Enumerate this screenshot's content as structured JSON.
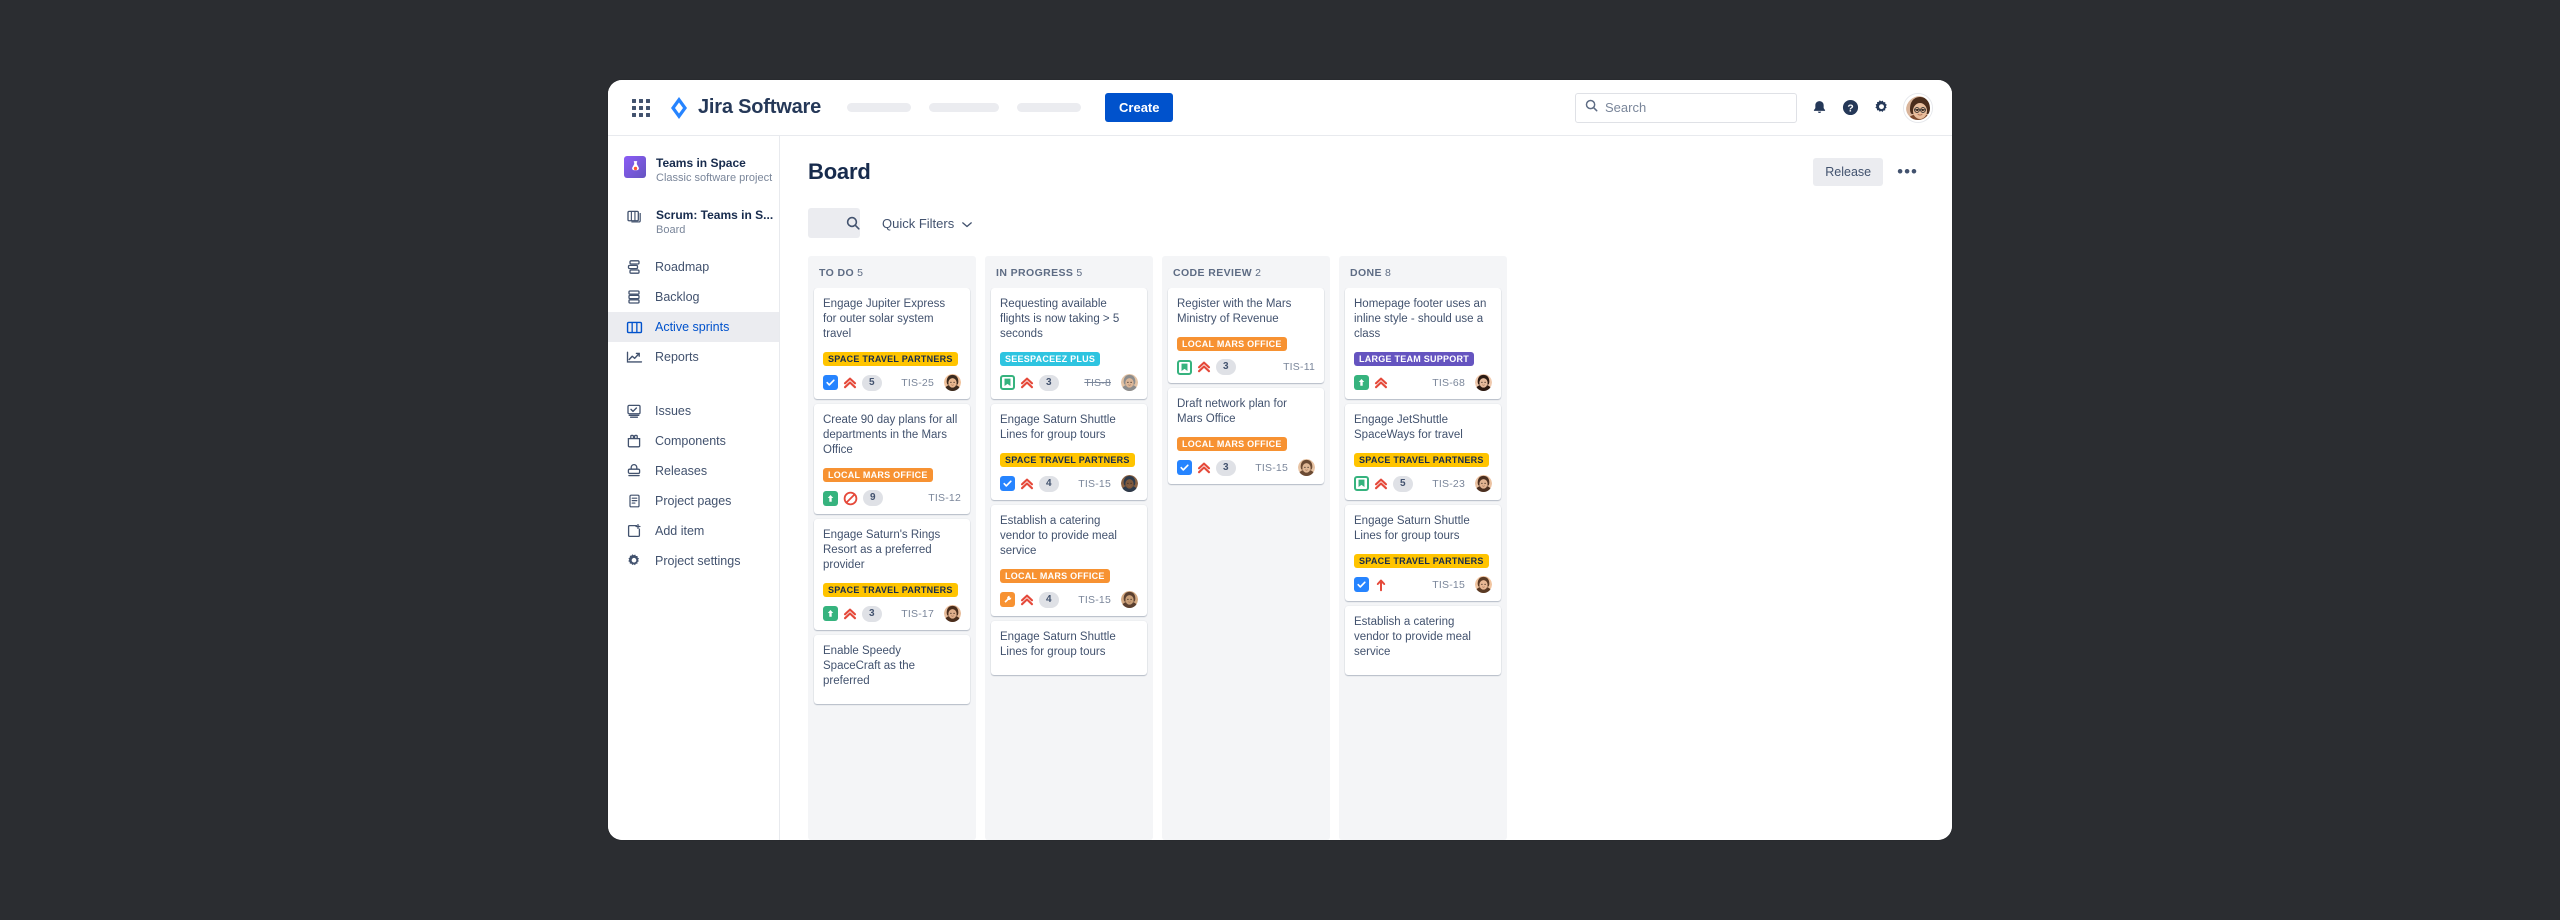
{
  "topnav": {
    "app_switcher_icon": "grid-apps-icon",
    "brand": "Jira Software",
    "brand_icon": "jira-logo-icon",
    "create_label": "Create",
    "search_placeholder": "Search",
    "search_value": "",
    "search_icon": "search-icon",
    "notifications_icon": "bell-icon",
    "help_icon": "help-circle-icon",
    "settings_icon": "gear-icon",
    "profile_icon": "user-avatar"
  },
  "sidebar": {
    "project": {
      "name": "Teams in Space",
      "subtitle": "Classic software project",
      "avatar_icon": "project-rocket-icon"
    },
    "board": {
      "name": "Scrum: Teams in S...",
      "subtitle": "Board",
      "icon": "board-stack-icon",
      "chevron_icon": "chevron-down-icon"
    },
    "items": [
      {
        "label": "Roadmap",
        "icon": "roadmap-icon",
        "active": false
      },
      {
        "label": "Backlog",
        "icon": "backlog-icon",
        "active": false
      },
      {
        "label": "Active sprints",
        "icon": "active-sprints-icon",
        "active": true
      },
      {
        "label": "Reports",
        "icon": "reports-icon",
        "active": false
      }
    ],
    "items2": [
      {
        "label": "Issues",
        "icon": "issues-icon",
        "active": false
      },
      {
        "label": "Components",
        "icon": "components-icon",
        "active": false
      },
      {
        "label": "Releases",
        "icon": "releases-icon",
        "active": false
      },
      {
        "label": "Project pages",
        "icon": "project-pages-icon",
        "active": false
      },
      {
        "label": "Add item",
        "icon": "add-item-icon",
        "active": false
      },
      {
        "label": "Project settings",
        "icon": "project-settings-icon",
        "active": false
      }
    ]
  },
  "main": {
    "title": "Board",
    "release_label": "Release",
    "more_label": "•••",
    "search_icon": "search-icon",
    "search_value": "",
    "quick_filters_label": "Quick Filters",
    "quick_filters_chevron": "chevron-down-icon"
  },
  "colors": {
    "brand_blue": "#0052cc",
    "label_yellow": "#ffc400",
    "label_orange": "#f79232",
    "label_teal": "#2ec4e0",
    "label_purple": "#6554c0",
    "type_task_blue": "#2684ff",
    "type_story_green": "#36b37e",
    "priority_red": "#e5493a",
    "column_bg": "#f4f5f7",
    "text_primary": "#172b4d",
    "text_muted": "#5e6c84"
  },
  "board": {
    "columns": [
      {
        "name": "TO DO",
        "count": "5",
        "cards": [
          {
            "title": "Engage Jupiter Express for outer solar system travel",
            "label": "SPACE TRAVEL PARTNERS",
            "label_color": "yellow",
            "type": "task",
            "priority": "highest",
            "points": "5",
            "key": "TIS-25",
            "key_done": false,
            "avatar": "avatar-male-1"
          },
          {
            "title": "Create 90 day plans for all departments in the Mars Office",
            "label": "LOCAL MARS OFFICE",
            "label_color": "orange",
            "type": "story",
            "priority": "blocker",
            "points": "9",
            "key": "TIS-12",
            "key_done": false,
            "avatar": null
          },
          {
            "title": "Engage Saturn's Rings Resort as a preferred provider",
            "label": "SPACE TRAVEL PARTNERS",
            "label_color": "yellow",
            "type": "story",
            "priority": "highest",
            "points": "3",
            "key": "TIS-17",
            "key_done": false,
            "avatar": "avatar-female-1"
          },
          {
            "title": "Enable Speedy SpaceCraft as the preferred",
            "label": null,
            "label_color": null,
            "type": null,
            "priority": null,
            "points": null,
            "key": null,
            "key_done": false,
            "avatar": null
          }
        ]
      },
      {
        "name": "IN PROGRESS",
        "count": "5",
        "cards": [
          {
            "title": "Requesting available flights is now taking > 5 seconds",
            "label": "SEESPACEEZ PLUS",
            "label_color": "teal",
            "type": "story-bookmark",
            "priority": "highest",
            "points": "3",
            "key": "TIS-8",
            "key_done": true,
            "avatar": "avatar-male-2"
          },
          {
            "title": "Engage Saturn Shuttle Lines for group tours",
            "label": "SPACE TRAVEL PARTNERS",
            "label_color": "yellow",
            "type": "task",
            "priority": "highest",
            "points": "4",
            "key": "TIS-15",
            "key_done": false,
            "avatar": "avatar-male-3"
          },
          {
            "title": "Establish a catering vendor to provide meal service",
            "label": "LOCAL MARS OFFICE",
            "label_color": "orange",
            "type": "subtask",
            "priority": "highest",
            "points": "4",
            "key": "TIS-15",
            "key_done": false,
            "avatar": "avatar-female-2"
          },
          {
            "title": "Engage Saturn Shuttle Lines for group tours",
            "label": null,
            "label_color": null,
            "type": null,
            "priority": null,
            "points": null,
            "key": null,
            "key_done": false,
            "avatar": null
          }
        ]
      },
      {
        "name": "CODE REVIEW",
        "count": "2",
        "cards": [
          {
            "title": "Register with the Mars Ministry of Revenue",
            "label": "LOCAL MARS OFFICE",
            "label_color": "orange",
            "type": "story-bookmark",
            "priority": "highest",
            "points": "3",
            "key": "TIS-11",
            "key_done": false,
            "avatar": null
          },
          {
            "title": "Draft network plan for Mars Office",
            "label": "LOCAL MARS OFFICE",
            "label_color": "orange",
            "type": "task",
            "priority": "highest",
            "points": "3",
            "key": "TIS-15",
            "key_done": false,
            "avatar": "avatar-female-3"
          }
        ]
      },
      {
        "name": "DONE",
        "count": "8",
        "cards": [
          {
            "title": "Homepage footer uses an inline style - should use a class",
            "label": "LARGE TEAM SUPPORT",
            "label_color": "purple",
            "type": "story",
            "priority": "highest",
            "points": null,
            "key": "TIS-68",
            "key_done": false,
            "avatar": "avatar-female-4"
          },
          {
            "title": "Engage JetShuttle SpaceWays for travel",
            "label": "SPACE TRAVEL PARTNERS",
            "label_color": "yellow",
            "type": "story-bookmark",
            "priority": "highest",
            "points": "5",
            "key": "TIS-23",
            "key_done": false,
            "avatar": "avatar-female-5"
          },
          {
            "title": "Engage Saturn Shuttle Lines for group tours",
            "label": "SPACE TRAVEL PARTNERS",
            "label_color": "yellow",
            "type": "task",
            "priority": "high",
            "points": null,
            "key": "TIS-15",
            "key_done": false,
            "avatar": "avatar-male-4"
          },
          {
            "title": "Establish a catering vendor to provide meal service",
            "label": null,
            "label_color": null,
            "type": null,
            "priority": null,
            "points": null,
            "key": null,
            "key_done": false,
            "avatar": null
          }
        ]
      }
    ]
  }
}
